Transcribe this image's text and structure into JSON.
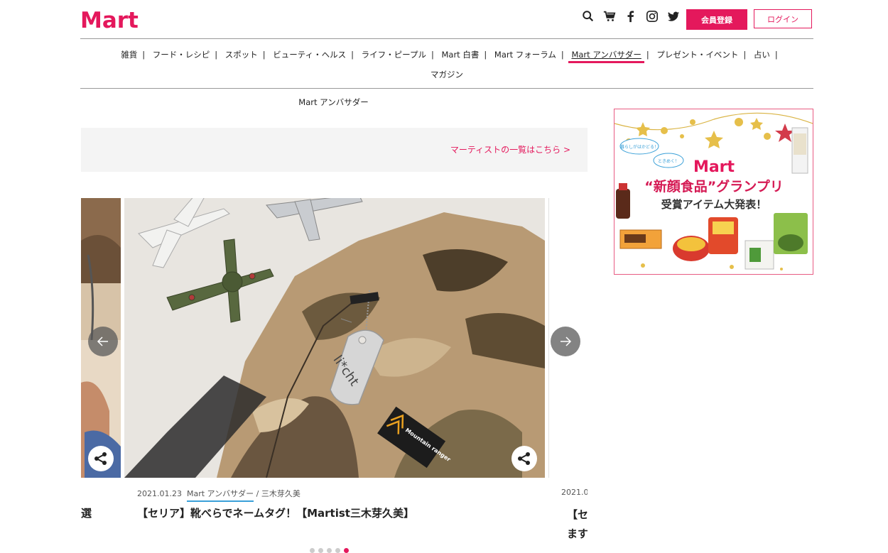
{
  "header": {
    "logo": "Mart",
    "register_label": "会員登録",
    "login_label": "ログイン",
    "icons": [
      "search-icon",
      "cart-icon",
      "facebook-icon",
      "instagram-icon",
      "twitter-icon"
    ]
  },
  "nav": {
    "items": [
      {
        "label": "雑貨"
      },
      {
        "label": "フード・レシピ"
      },
      {
        "label": "スポット"
      },
      {
        "label": "ビューティ・ヘルス"
      },
      {
        "label": "ライフ・ピープル"
      },
      {
        "label": "Mart 白書"
      },
      {
        "label": "Mart フォーラム"
      },
      {
        "label": "Mart アンバサダー"
      },
      {
        "label": "プレゼント・イベント"
      },
      {
        "label": "占い"
      },
      {
        "label": "マガジン"
      }
    ],
    "active": "Mart アンバサダー"
  },
  "breadcrumb": "Mart アンバサダー",
  "martist_link": "マーティストの一覧はこちら >",
  "carousel": {
    "left_title_fragment": "選",
    "main": {
      "date": "2021.01.23",
      "category": "Mart アンバサダー",
      "separator": "/",
      "author": "三木芽久美",
      "title": "【セリア】靴べらでネームタグ！【Martist三木芽久美】",
      "tag_text": "li*cht",
      "patch_text": "Mountain ranger"
    },
    "right": {
      "date": "2021.0",
      "title_line1": "【セ",
      "title_line2": "ます"
    },
    "dot_count": 5,
    "active_dot": 4
  },
  "ad": {
    "badge1": "暮らしがはかどる！",
    "badge2": "ときめく！",
    "brand": "Mart",
    "headline": "“新顔食品”グランプリ",
    "subline": "受賞アイテム大発表！"
  },
  "colors": {
    "accent": "#e4185c",
    "link_underline": "#3aa0d8"
  }
}
